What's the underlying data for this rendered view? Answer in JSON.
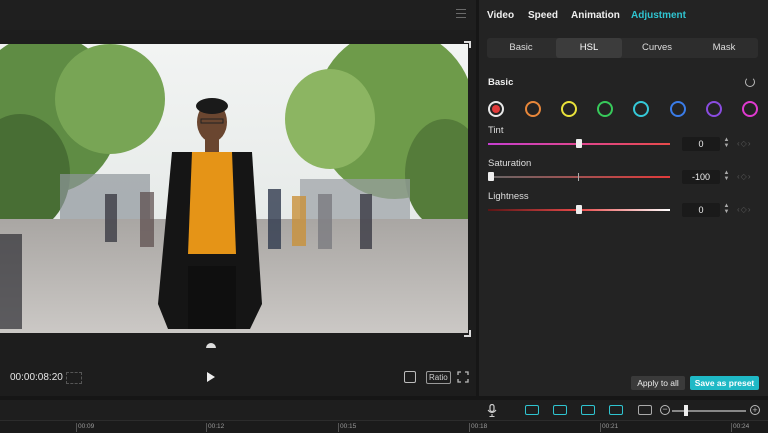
{
  "player": {
    "timecode": "00:00:08:20",
    "ratio_label": "Ratio"
  },
  "panel": {
    "tabs": [
      {
        "label": "Video",
        "active": false
      },
      {
        "label": "Speed",
        "active": false
      },
      {
        "label": "Animation",
        "active": false
      },
      {
        "label": "Adjustment",
        "active": true
      }
    ],
    "subtabs": [
      {
        "label": "Basic",
        "active": false
      },
      {
        "label": "HSL",
        "active": true
      },
      {
        "label": "Curves",
        "active": false
      },
      {
        "label": "Mask",
        "active": false
      }
    ],
    "section_title": "Basic",
    "swatches": [
      {
        "name": "red",
        "color": "#e23b3b",
        "selected": true
      },
      {
        "name": "orange",
        "color": "#e8873a"
      },
      {
        "name": "yellow",
        "color": "#e9e23a"
      },
      {
        "name": "green",
        "color": "#37c95a"
      },
      {
        "name": "cyan",
        "color": "#35c9d8"
      },
      {
        "name": "blue",
        "color": "#3a7ce8"
      },
      {
        "name": "purple",
        "color": "#8a4ce0"
      },
      {
        "name": "magenta",
        "color": "#e03ad0"
      }
    ],
    "sliders": {
      "tint": {
        "label": "Tint",
        "value": "0"
      },
      "saturation": {
        "label": "Saturation",
        "value": "-100"
      },
      "lightness": {
        "label": "Lightness",
        "value": "0"
      }
    },
    "apply_all_label": "Apply to all",
    "save_preset_label": "Save as preset",
    "accent_color": "#1fb9c6"
  },
  "timeline": {
    "ticks": [
      "00:09",
      "00:12",
      "00:15",
      "00:18",
      "00:21",
      "00:24"
    ]
  }
}
